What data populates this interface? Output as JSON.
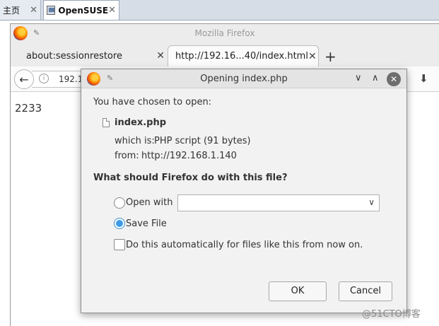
{
  "vm_tabs": {
    "home_label": "主页",
    "opensuse_label": "OpenSUSE",
    "close_glyph": "✕"
  },
  "firefox": {
    "window_title": "Mozilla Firefox",
    "tabs": [
      {
        "label": "about:sessionrestore"
      },
      {
        "label": "http://192.16...40/index.html"
      }
    ],
    "tab_close_glyph": "✕",
    "new_tab_glyph": "+",
    "url_text": "192.1",
    "back_glyph": "←",
    "download_glyph": "⬇",
    "page_text": "2233"
  },
  "dialog": {
    "title": "Opening index.php",
    "minimize_glyph": "∨",
    "maximize_glyph": "∧",
    "close_glyph": "✕",
    "intro": "You have chosen to open:",
    "filename": "index.php",
    "which_is_label": "which is:",
    "which_is_value": "PHP script (91 bytes)",
    "from_label": "from:",
    "from_value": "http://192.168.1.140",
    "question": "What should Firefox do with this file?",
    "open_with_label": "Open with",
    "open_with_value": "",
    "save_file_label": "Save File",
    "auto_label": "Do this automatically for files like this from now on.",
    "ok_label": "OK",
    "cancel_label": "Cancel",
    "selected_option": "save_file",
    "auto_checked": false
  },
  "watermark": "@51CTO博客",
  "colors": {
    "radio_accent": "#3c9be8",
    "dialog_bg": "#f2f2f2"
  },
  "icons": {
    "firefox": "firefox-logo-icon",
    "pin": "pin-icon",
    "vm": "vm-tab-icon",
    "file": "file-icon",
    "info": "info-icon",
    "download": "download-icon"
  }
}
